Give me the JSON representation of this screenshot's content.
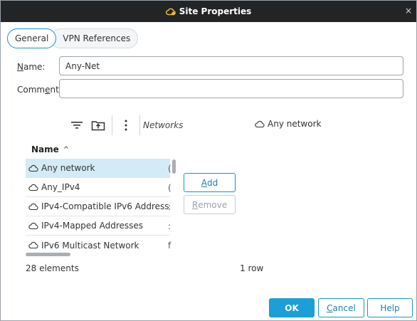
{
  "window": {
    "title": "Site Properties",
    "close_glyph": "×",
    "title_icon": "site-cloud-icon"
  },
  "tabs": [
    {
      "label": "General",
      "active": true
    },
    {
      "label": "VPN References",
      "active": false
    }
  ],
  "form": {
    "name_label_accel": "N",
    "name_label_rest": "ame:",
    "name_value": "Any-Net",
    "comment_label_pre": "Comm",
    "comment_label_accel": "e",
    "comment_label_rest": "nt:",
    "comment_value": ""
  },
  "toolbar": {
    "icons": [
      "filter-icon",
      "add-folder-icon",
      "more-vertical-icon"
    ],
    "networks_label": "Networks",
    "selected_network": "Any network"
  },
  "grid": {
    "header": "Name",
    "sort_glyph": "^",
    "rows": [
      {
        "label": "Any network",
        "extra": "(",
        "selected": true
      },
      {
        "label": "Any_IPv4",
        "extra": "(",
        "selected": false
      },
      {
        "label": "IPv4-Compatible IPv6 Address...",
        "extra": ":",
        "selected": false
      },
      {
        "label": "IPv4-Mapped Addresses",
        "extra": ":",
        "selected": false
      },
      {
        "label": "IPv6 Multicast Network",
        "extra": "f",
        "selected": false
      }
    ],
    "count": "28 elements"
  },
  "actions": {
    "add_accel": "A",
    "add_rest": "dd",
    "remove_accel": "R",
    "remove_rest": "emove"
  },
  "selection_count": "1 row",
  "footer": {
    "ok": "OK",
    "cancel_accel": "C",
    "cancel_rest": "ancel",
    "help": "Help"
  },
  "colors": {
    "accent": "#1a9fd6",
    "titlebar": "#222426",
    "selection": "#d3ebf7"
  }
}
